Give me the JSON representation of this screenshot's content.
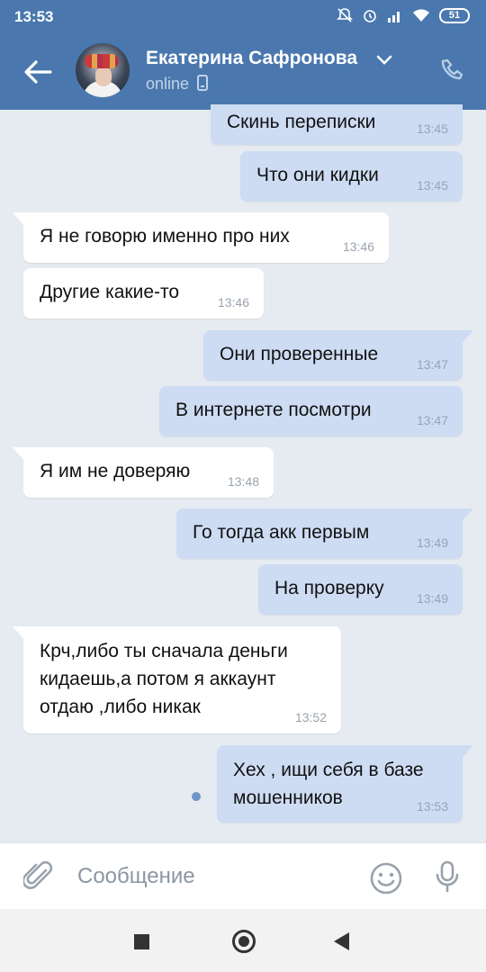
{
  "status_bar": {
    "time": "13:53",
    "battery_level": "51"
  },
  "header": {
    "contact_name": "Екатерина Сафронова",
    "contact_status": "online"
  },
  "messages": [
    {
      "direction": "outgoing",
      "text": "Скинь переписки",
      "time": "13:45"
    },
    {
      "direction": "outgoing",
      "text": "Что они кидки",
      "time": "13:45"
    },
    {
      "direction": "incoming",
      "text": "Я не говорю именно про них",
      "time": "13:46"
    },
    {
      "direction": "incoming",
      "text": "Другие какие-то",
      "time": "13:46"
    },
    {
      "direction": "outgoing",
      "text": "Они проверенные",
      "time": "13:47"
    },
    {
      "direction": "outgoing",
      "text": "В интернете посмотри",
      "time": "13:47"
    },
    {
      "direction": "incoming",
      "text": "Я им не доверяю",
      "time": "13:48"
    },
    {
      "direction": "outgoing",
      "text": "Го тогда акк первым",
      "time": "13:49"
    },
    {
      "direction": "outgoing",
      "text": "На проверку",
      "time": "13:49"
    },
    {
      "direction": "incoming",
      "text": "Крч,либо ты сначала деньги кидаешь,а потом я аккаунт отдаю ,либо никак",
      "time": "13:52"
    },
    {
      "direction": "outgoing",
      "text": "Хех , ищи себя в базе мошенников",
      "time": "13:53",
      "unread": true
    }
  ],
  "composer": {
    "placeholder": "Сообщение"
  },
  "colors": {
    "header": "#4a78ae",
    "chat_background": "#e6ebf1",
    "outgoing_bubble": "#cddcf2",
    "incoming_bubble": "#ffffff",
    "unread_dot": "#6f96c6"
  },
  "icons": [
    "back-arrow-icon",
    "chevron-down-icon",
    "phone-icon",
    "mobile-device-icon",
    "paperclip-icon",
    "emoji-icon",
    "microphone-icon",
    "nav-recents-icon",
    "nav-home-icon",
    "nav-back-icon"
  ]
}
